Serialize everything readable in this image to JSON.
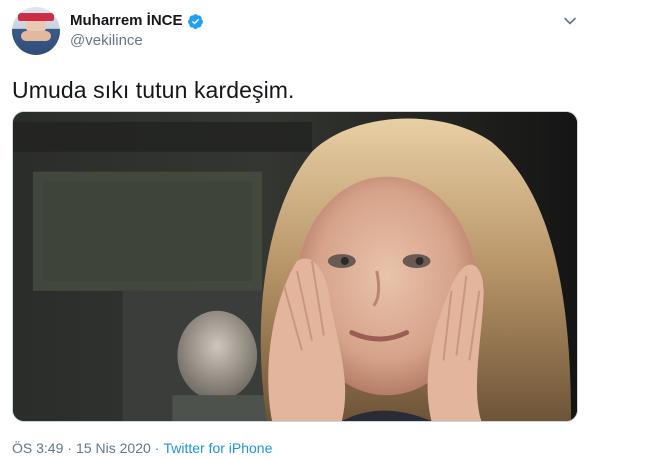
{
  "author": {
    "display_name": "Muharrem İNCE",
    "handle": "@vekilince",
    "verified": true
  },
  "tweet": {
    "text": "Umuda sıkı tutun kardeşim.",
    "time": "ÖS 3:49",
    "date": "15 Nis 2020",
    "source": "Twitter for iPhone",
    "separator": "·"
  },
  "icons": {
    "verified": "verified-badge-icon",
    "menu": "chevron-down-icon"
  },
  "colors": {
    "text": "#14171a",
    "secondary": "#657786",
    "link": "#1b95e0",
    "verified": "#1da1f2"
  }
}
